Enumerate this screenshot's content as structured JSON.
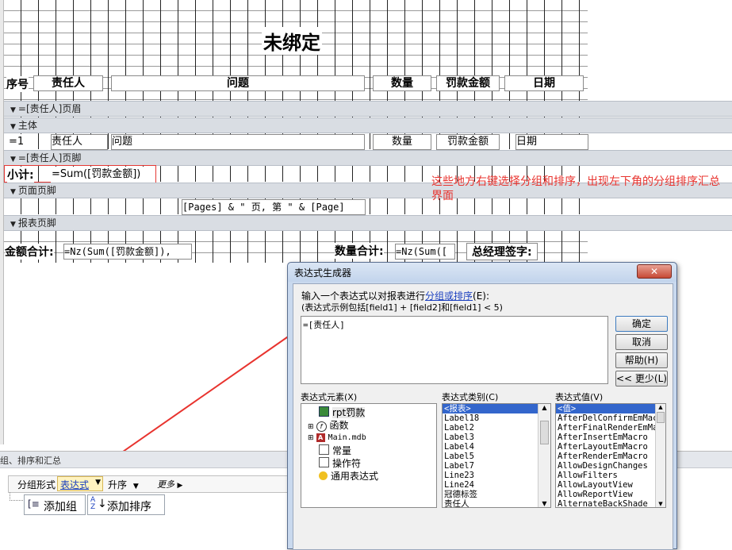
{
  "report": {
    "title": "未绑定",
    "headers": {
      "seq": "序号",
      "person": "责任人",
      "issue": "问题",
      "qty": "数量",
      "fine": "罚款金额",
      "date": "日期"
    },
    "bands": {
      "group_header": "=[责任人]页眉",
      "detail": "主体",
      "group_footer": "=[责任人]页脚",
      "page_footer": "页面页脚",
      "report_footer": "报表页脚"
    },
    "detail_fields": {
      "seq": "=1",
      "person": "责任人",
      "issue": "问题",
      "qty": "数量",
      "fine": "罚款金额",
      "date": "日期"
    },
    "subtotal_label": "小计:",
    "subtotal_expr": "=Sum([罚款金额])",
    "page_expr": "[Pages] & \" 页, 第 \" & [Page]",
    "amount_total_label": "金额合计:",
    "amount_total_expr": "=Nz(Sum([罚款金额]),",
    "qty_total_label": "数量合计:",
    "qty_total_expr": "=Nz(Sum([",
    "manager_label": "总经理签字:"
  },
  "annotation": "这些地方右键选择分组和排序，出现左下角的分组排序汇总界面",
  "annotation_color": "#e8332e",
  "group_pane": {
    "title": "组、排序和汇总",
    "group_form": "分组形式",
    "expr_button": "表达式",
    "order": "升序",
    "more": "更多",
    "add_group": "添加组",
    "add_sort": "添加排序"
  },
  "dialog": {
    "title": "表达式生成器",
    "prompt_prefix": "输入一个表达式以对报表进行",
    "prompt_link": "分组或排序",
    "prompt_suffix": "(E):",
    "example": "(表达式示例包括[field1] + [field2]和[field1] < 5)",
    "expression": "=[责任人]",
    "buttons": {
      "ok": "确定",
      "cancel": "取消",
      "help": "帮助(H)",
      "less": "<< 更少(L)"
    },
    "elements_label": "表达式元素(X)",
    "categories_label": "表达式类别(C)",
    "values_label": "表达式值(V)",
    "elements": [
      "rpt罚款",
      "函数",
      "Main.mdb",
      "常量",
      "操作符",
      "通用表达式"
    ],
    "categories": [
      "<报表>",
      "Label18",
      "Label2",
      "Label3",
      "Label4",
      "Label5",
      "Label7",
      "Line23",
      "Line24",
      "冠德标签",
      "责任人"
    ],
    "values": [
      "<值>",
      "AfterDelConfirmEmMac",
      "AfterFinalRenderEmMa",
      "AfterInsertEmMacro",
      "AfterLayoutEmMacro",
      "AfterRenderEmMacro",
      "AllowDesignChanges",
      "AllowFilters",
      "AllowLayoutView",
      "AllowReportView",
      "AlternateBackShade"
    ]
  }
}
